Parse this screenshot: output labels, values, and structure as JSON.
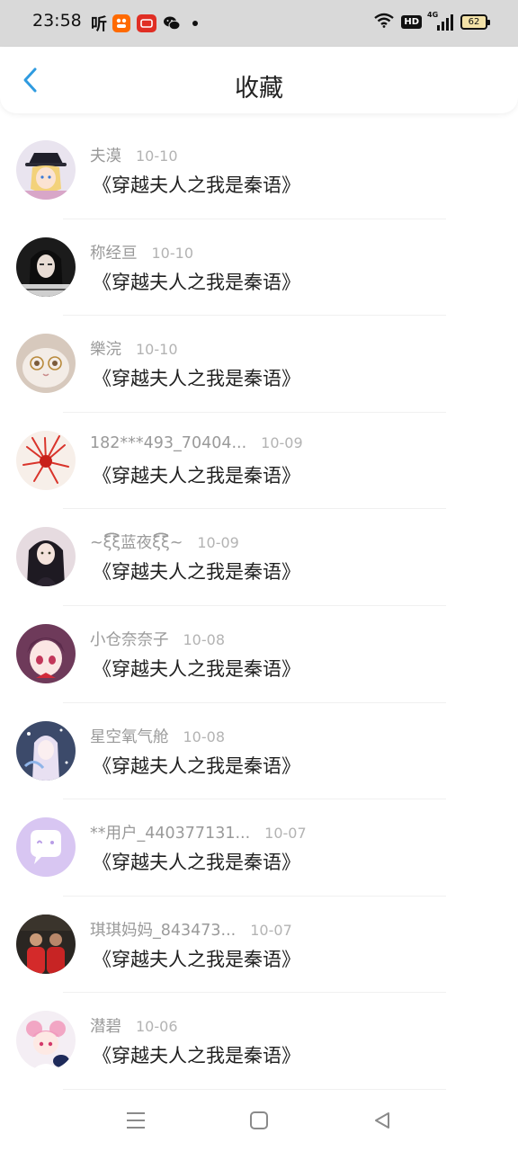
{
  "status_bar": {
    "time": "23:58",
    "ting_label": "听",
    "app_icons": [
      "taobao-icon",
      "pinduoduo-icon",
      "wechat-icon"
    ],
    "hd_label": "HD",
    "network_label": "4G",
    "battery": "62"
  },
  "header": {
    "title": "收藏",
    "back_icon": "chevron-left-icon",
    "accent_color": "#2f9be0"
  },
  "items": [
    {
      "name": "夫漠",
      "date": "10-10",
      "book": "《穿越夫人之我是秦语》"
    },
    {
      "name": "称经亘",
      "date": "10-10",
      "book": "《穿越夫人之我是秦语》"
    },
    {
      "name": "樂浣",
      "date": "10-10",
      "book": "《穿越夫人之我是秦语》"
    },
    {
      "name": "182***493_70404...",
      "date": "10-09",
      "book": "《穿越夫人之我是秦语》"
    },
    {
      "name": "~ξ͡͡͡͡ξ蓝夜ξ͡͡͡͡ξ~",
      "date": "10-09",
      "book": "《穿越夫人之我是秦语》"
    },
    {
      "name": "小仓奈奈子",
      "date": "10-08",
      "book": "《穿越夫人之我是秦语》"
    },
    {
      "name": "星空氧气舱",
      "date": "10-08",
      "book": "《穿越夫人之我是秦语》"
    },
    {
      "name": "**用户_440377131...",
      "date": "10-07",
      "book": "《穿越夫人之我是秦语》"
    },
    {
      "name": "琪琪妈妈_843473...",
      "date": "10-07",
      "book": "《穿越夫人之我是秦语》"
    },
    {
      "name": "潜碧",
      "date": "10-06",
      "book": "《穿越夫人之我是秦语》"
    }
  ],
  "nav_bar": {
    "icons": [
      "menu-icon",
      "home-square-icon",
      "back-triangle-icon"
    ]
  }
}
